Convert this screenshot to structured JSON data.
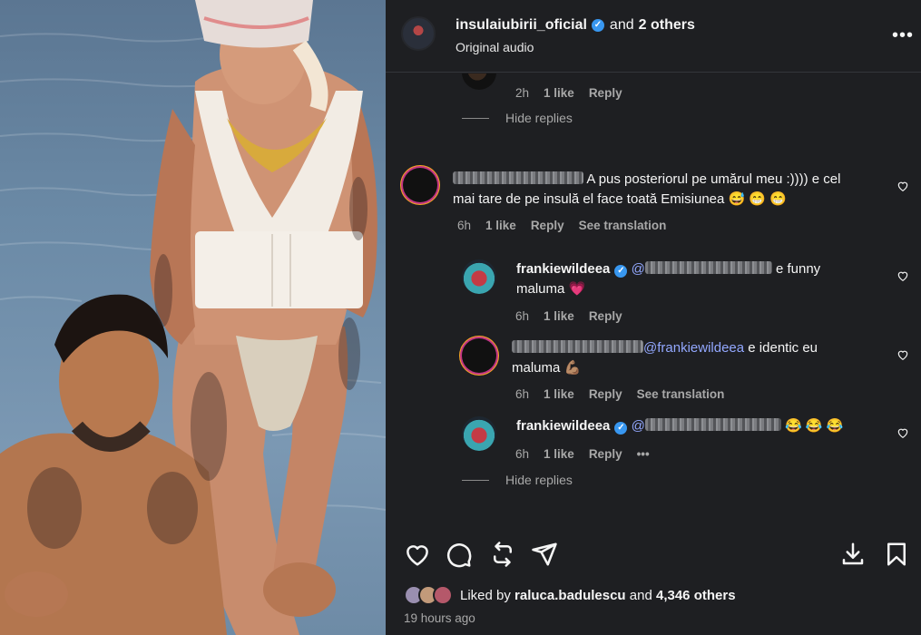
{
  "header": {
    "username": "insulaiubirii_oficial",
    "and_text": "and",
    "others_text": "2 others",
    "audio_label": "Original audio",
    "more_label": "•••"
  },
  "verified_glyph": "✓",
  "top_reply": {
    "time": "2h",
    "likes": "1 like",
    "reply": "Reply"
  },
  "hide_replies_1": "Hide replies",
  "comment_main": {
    "text_line1": "A pus posteriorul pe umărul meu :)))) e cel",
    "text_line2": "mai tare de pe insulă el face toată Emisiunea 😅 😁 😁",
    "time": "6h",
    "likes": "1 like",
    "reply": "Reply",
    "see_translation": "See translation"
  },
  "reply_1": {
    "username": "frankiewildeea",
    "mention_prefix": "@",
    "text_after": "e funny",
    "text_line2": "maluma 💗",
    "time": "6h",
    "likes": "1 like",
    "reply": "Reply"
  },
  "reply_2": {
    "mention": "@frankiewildeea",
    "text_after": " e identic eu",
    "text_line2": "maluma 💪🏽",
    "time": "6h",
    "likes": "1 like",
    "reply": "Reply",
    "see_translation": "See translation"
  },
  "reply_3": {
    "username": "frankiewildeea",
    "mention_prefix": "@",
    "emojis": "😂 😂 😂",
    "time": "6h",
    "likes": "1 like",
    "reply": "Reply",
    "more": "•••"
  },
  "hide_replies_2": "Hide replies",
  "likes_bar": {
    "prefix": "Liked by",
    "user": "raluca.badulescu",
    "and_text": "and",
    "others": "4,346 others"
  },
  "post_time": "19 hours ago",
  "colors": {
    "panel_bg": "#1e1f22",
    "verified": "#3897f0",
    "mention": "#93a8ff",
    "meta": "#a8a8a8"
  },
  "icons": [
    "heart-icon",
    "comment-icon",
    "repost-icon",
    "share-icon",
    "download-icon",
    "bookmark-icon"
  ]
}
